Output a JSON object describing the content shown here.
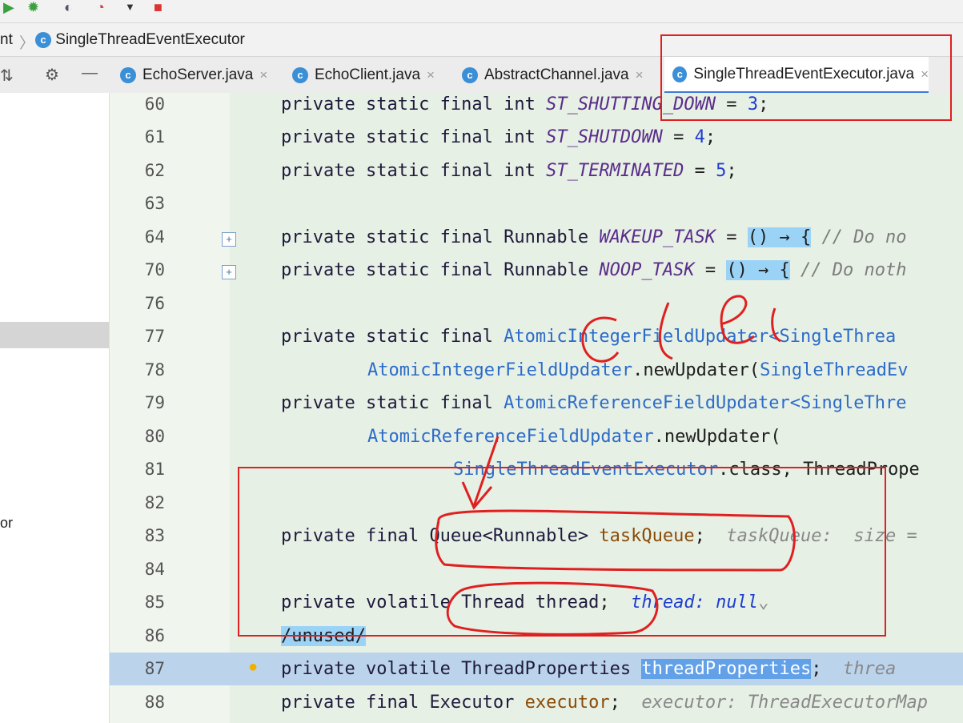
{
  "toolbar": {
    "icons": [
      "run-icon",
      "debug-icon",
      "coverage-icon",
      "profile-icon",
      "dropdown-icon",
      "stop-icon"
    ]
  },
  "breadcrumb": {
    "prev": "nt",
    "current": "SingleThreadEventExecutor"
  },
  "tabs": [
    {
      "label": "EchoServer.java",
      "close": "×"
    },
    {
      "label": "EchoClient.java",
      "close": "×"
    },
    {
      "label": "AbstractChannel.java",
      "close": "×"
    },
    {
      "label": "SingleThreadEventExecutor.java",
      "close": "×"
    }
  ],
  "side_panel": {
    "label": "or"
  },
  "code_lines": [
    {
      "num": "60",
      "kw": "private static final int ",
      "name": "ST_SHUTTING_DOWN",
      "eq": " = ",
      "val": "3",
      "end": ";"
    },
    {
      "num": "61",
      "kw": "private static final int ",
      "name": "ST_SHUTDOWN",
      "eq": " = ",
      "val": "4",
      "end": ";"
    },
    {
      "num": "62",
      "kw": "private static final int ",
      "name": "ST_TERMINATED",
      "eq": " = ",
      "val": "5",
      "end": ";"
    },
    {
      "num": "63"
    },
    {
      "num": "64",
      "kw": "private static final Runnable ",
      "name": "WAKEUP_TASK",
      "eq": " = ",
      "lam": "() → {",
      "cmt": " // Do no"
    },
    {
      "num": "70",
      "kw": "private static final Runnable ",
      "name": "NOOP_TASK",
      "eq": " = ",
      "lam": "() → {",
      "cmt": " // Do noth"
    },
    {
      "num": "76"
    },
    {
      "num": "77",
      "kw": "private static final ",
      "cls": "AtomicIntegerFieldUpdater",
      "rest": "<SingleThrea"
    },
    {
      "num": "78",
      "cls": "AtomicIntegerFieldUpdater",
      "rest": ".newUpdater(",
      "cls2": "SingleThreadEv"
    },
    {
      "num": "79",
      "kw": "private static final ",
      "cls": "AtomicReferenceFieldUpdater",
      "rest": "<SingleThre"
    },
    {
      "num": "80",
      "cls": "AtomicReferenceFieldUpdater",
      "rest": ".newUpdater("
    },
    {
      "num": "81",
      "cls": "SingleThreadEventExecutor",
      "rest": ".class, ThreadPrope"
    },
    {
      "num": "82"
    },
    {
      "num": "83",
      "kw": "private final ",
      "type": "Queue<Runnable> ",
      "fld": "taskQueue",
      "end": ";",
      "hint": "  taskQueue:  size = "
    },
    {
      "num": "84"
    },
    {
      "num": "85",
      "kw": "private volatile ",
      "type": "Thread ",
      "fld": "thread",
      "end": ";",
      "hint": "  thread: null",
      "hint_chev": "⌄"
    },
    {
      "num": "86",
      "cmt": "/unused/"
    },
    {
      "num": "87",
      "kw": "private volatile ",
      "type": "ThreadProperties ",
      "fld": "threadProperties",
      "end": ";",
      "hint": "  threa"
    },
    {
      "num": "88",
      "kw": "private final ",
      "type": "Executor ",
      "fld": "executor",
      "end": ";",
      "hint": "  executor: ThreadExecutorMap"
    }
  ],
  "annotations": {
    "color": "#e02020",
    "handwritten_text": "CLEl"
  },
  "colors": {
    "editor_bg": "#e7f0e5",
    "keyword": "#1f1a3c",
    "class_ref": "#2c6cc9",
    "number": "#1f3dd1",
    "field": "#8a4b07",
    "constant": "#5a2d8a",
    "highlight_line": "#bcd3ec"
  }
}
